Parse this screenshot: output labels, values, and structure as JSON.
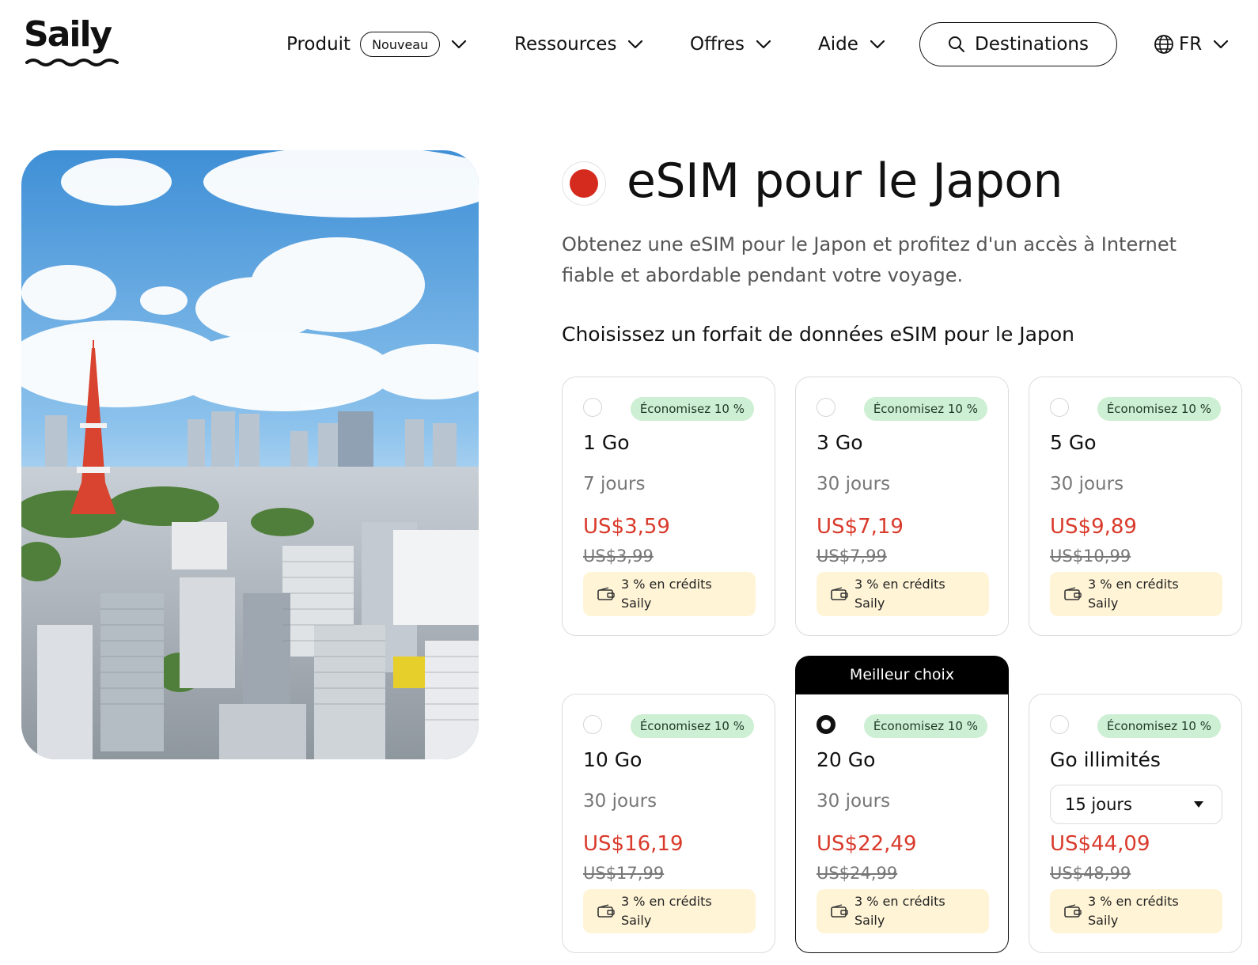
{
  "header": {
    "logo": "Saily",
    "nav": [
      {
        "label": "Produit",
        "badge": "Nouveau"
      },
      {
        "label": "Ressources"
      },
      {
        "label": "Offres"
      },
      {
        "label": "Aide"
      }
    ],
    "destinations_label": "Destinations",
    "lang": "FR"
  },
  "main": {
    "title": "eSIM pour le Japon",
    "subtitle": "Obtenez une eSIM pour le Japon et profitez d'un accès à Internet fiable et abordable pendant votre voyage.",
    "plans_heading": "Choisissez un forfait de données eSIM pour le Japon",
    "best_choice_label": "Meilleur choix",
    "plans": [
      {
        "data": "1 Go",
        "days": "7 jours",
        "price": "US$3,59",
        "old_price": "US$3,99",
        "save": "Économisez 10 %",
        "credit": "3 % en crédits Saily",
        "selected": false
      },
      {
        "data": "3 Go",
        "days": "30 jours",
        "price": "US$7,19",
        "old_price": "US$7,99",
        "save": "Économisez 10 %",
        "credit": "3 % en crédits Saily",
        "selected": false
      },
      {
        "data": "5 Go",
        "days": "30 jours",
        "price": "US$9,89",
        "old_price": "US$10,99",
        "save": "Économisez 10 %",
        "credit": "3 % en crédits Saily",
        "selected": false
      },
      {
        "data": "10 Go",
        "days": "30 jours",
        "price": "US$16,19",
        "old_price": "US$17,99",
        "save": "Économisez 10 %",
        "credit": "3 % en crédits Saily",
        "selected": false
      },
      {
        "data": "20 Go",
        "days": "30 jours",
        "price": "US$22,49",
        "old_price": "US$24,99",
        "save": "Économisez 10 %",
        "credit": "3 % en crédits Saily",
        "selected": true
      },
      {
        "data": "Go illimités",
        "days": "15 jours",
        "price": "US$44,09",
        "old_price": "US$48,99",
        "save": "Économisez 10 %",
        "credit": "3 % en crédits Saily",
        "selected": false
      }
    ]
  },
  "colors": {
    "accent_price": "#d93a2b",
    "save_badge_bg": "#cdefd3",
    "credit_bg": "#fff4d6",
    "flag_red": "#d42b1e"
  },
  "icons": {
    "search": "search-icon",
    "chevron": "chevron-down-icon",
    "globe": "globe-icon",
    "wallet": "wallet-icon",
    "caret": "caret-down-icon"
  }
}
